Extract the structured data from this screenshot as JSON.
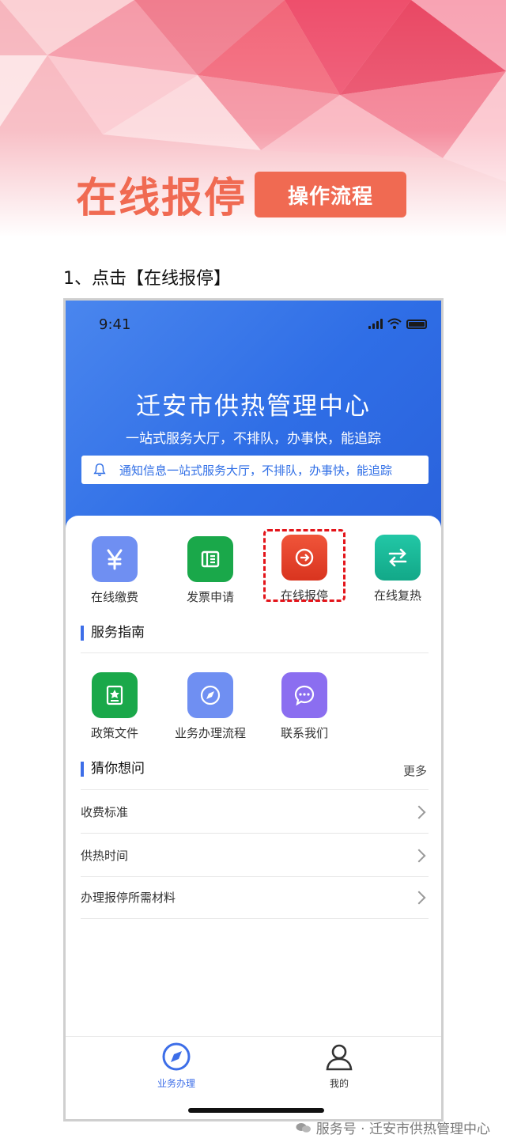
{
  "header": {
    "title": "在线报停",
    "badge": "操作流程",
    "step": "1、点击【在线报停】"
  },
  "status": {
    "time": "9:41"
  },
  "app": {
    "center_name": "迁安市供热管理中心",
    "slogan": "一站式服务大厅，不排队，办事快，能追踪",
    "notice": "通知信息一站式服务大厅，不排队，办事快，能追踪"
  },
  "services": [
    {
      "label": "在线缴费",
      "icon": "yen-icon",
      "color": "#6f8ff2"
    },
    {
      "label": "发票申请",
      "icon": "invoice-icon",
      "color": "#1aa84a"
    },
    {
      "label": "在线报停",
      "icon": "pause-icon",
      "color": "#e9432a"
    },
    {
      "label": "在线复热",
      "icon": "swap-icon",
      "color": "#1fb89a"
    }
  ],
  "guide": {
    "title": "服务指南",
    "items": [
      {
        "label": "政策文件",
        "icon": "document-icon",
        "color": "#1aa84a"
      },
      {
        "label": "业务办理流程",
        "icon": "compass-icon",
        "color": "#6f8ff2"
      },
      {
        "label": "联系我们",
        "icon": "chat-icon",
        "color": "#8b6ef0"
      }
    ]
  },
  "faq": {
    "title": "猜你想问",
    "more": "更多",
    "items": [
      "收费标准",
      "供热时间",
      "办理报停所需材料"
    ]
  },
  "tabbar": {
    "tabs": [
      {
        "label": "业务办理",
        "icon": "compass-icon",
        "active": true
      },
      {
        "label": "我的",
        "icon": "user-icon",
        "active": false
      }
    ]
  },
  "watermark": "服务号 · 迁安市供热管理中心",
  "colors": {
    "accent": "#f06a52",
    "brand_blue": "#2f6ee6",
    "highlight": "#e3141a"
  }
}
